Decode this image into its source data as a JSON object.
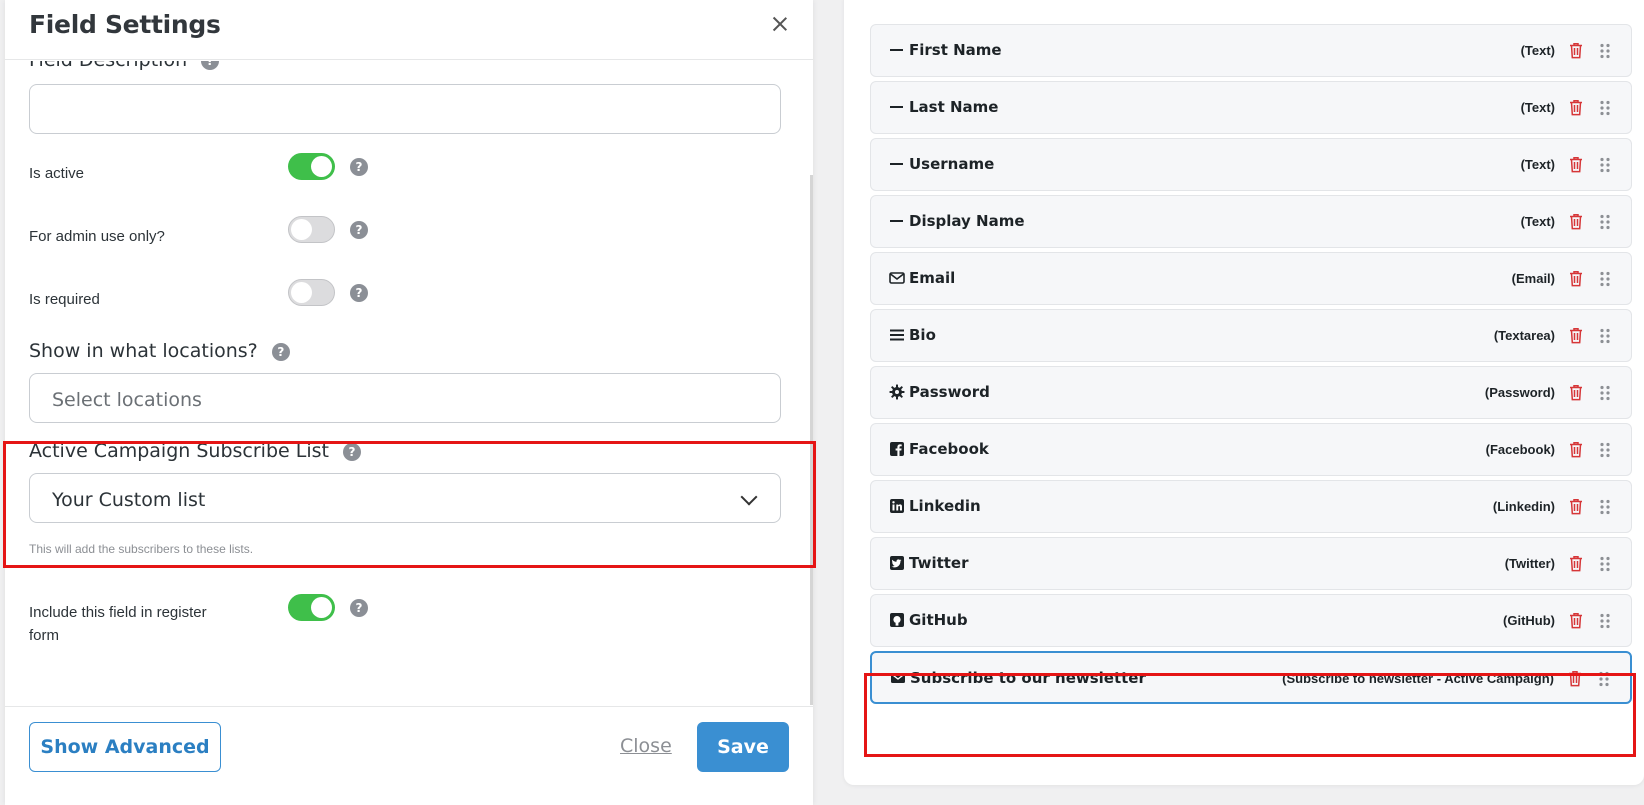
{
  "modal": {
    "title": "Field Settings",
    "field_description": {
      "label": "Field Description",
      "value": ""
    },
    "is_active": {
      "label": "Is active",
      "on": true
    },
    "admin_only": {
      "label": "For admin use only?",
      "on": false
    },
    "is_required": {
      "label": "Is required",
      "on": false
    },
    "locations": {
      "label": "Show in what locations?",
      "placeholder": "Select locations"
    },
    "campaign_list": {
      "label": "Active Campaign Subscribe List",
      "selected": "Your Custom list",
      "hint": "This will add the subscribers to these lists."
    },
    "include_register": {
      "label_line1": "Include this field in register",
      "label_line2": "form",
      "on": true
    },
    "footer": {
      "show_advanced": "Show Advanced",
      "close": "Close",
      "save": "Save"
    },
    "help_glyph": "?"
  },
  "fields": [
    {
      "label": "First Name",
      "type": "(Text)",
      "icon": "minus-icon"
    },
    {
      "label": "Last Name",
      "type": "(Text)",
      "icon": "minus-icon"
    },
    {
      "label": "Username",
      "type": "(Text)",
      "icon": "minus-icon"
    },
    {
      "label": "Display Name",
      "type": "(Text)",
      "icon": "minus-icon"
    },
    {
      "label": "Email",
      "type": "(Email)",
      "icon": "envelope-outline-icon"
    },
    {
      "label": "Bio",
      "type": "(Textarea)",
      "icon": "bars-icon"
    },
    {
      "label": "Password",
      "type": "(Password)",
      "icon": "gear-icon"
    },
    {
      "label": "Facebook",
      "type": "(Facebook)",
      "icon": "facebook-icon"
    },
    {
      "label": "Linkedin",
      "type": "(Linkedin)",
      "icon": "linkedin-icon"
    },
    {
      "label": "Twitter",
      "type": "(Twitter)",
      "icon": "twitter-icon"
    },
    {
      "label": "GitHub",
      "type": "(GitHub)",
      "icon": "github-icon"
    },
    {
      "label": "Subscribe to our newsletter",
      "type": "(Subscribe to newsletter - Active Campaign)",
      "icon": "envelope-filled-icon"
    }
  ],
  "colors": {
    "accent": "#3a8fd2",
    "toggle_on": "#3fbf4a",
    "danger": "#d63638",
    "highlight": "#e51515"
  }
}
